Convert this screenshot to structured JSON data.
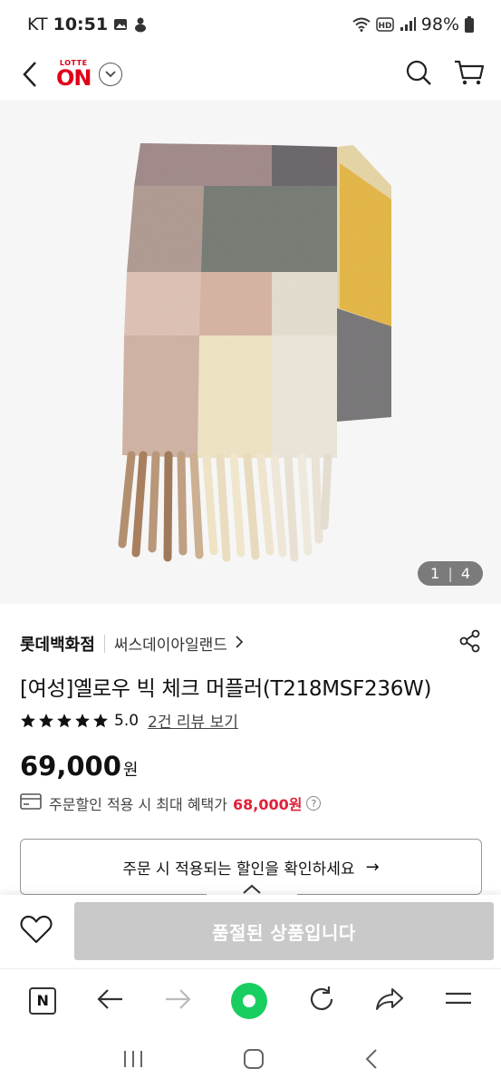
{
  "status_bar": {
    "carrier": "KT",
    "time": "10:51",
    "battery": "98%"
  },
  "header": {
    "logo_top": "LOTTE",
    "logo_main": "ON"
  },
  "product_image": {
    "counter_current": "1",
    "counter_total": "4",
    "counter_sep": "|"
  },
  "product": {
    "brand": "롯데백화점",
    "store": "써스데이아일랜드",
    "title": "[여성]옐로우 빅 체크 머플러(T218MSF236W)",
    "rating": "5.0",
    "stars": 5,
    "review_link": "2건 리뷰 보기",
    "price": "69,000",
    "price_unit": "원",
    "benefit_label": "주문할인 적용 시 최대 혜택가",
    "benefit_price": "68,000원",
    "discount_button": "주문 시 적용되는 할인을 확인하세요",
    "discount_arrow": "→"
  },
  "bottom_bar": {
    "sold_out_label": "품절된 상품입니다"
  },
  "browser": {
    "n_label": "N"
  },
  "colors": {
    "brand_red": "#e0001a",
    "benefit_red": "#e0213a",
    "sold_out_gray": "#c9c9c9",
    "green": "#19ce60"
  }
}
